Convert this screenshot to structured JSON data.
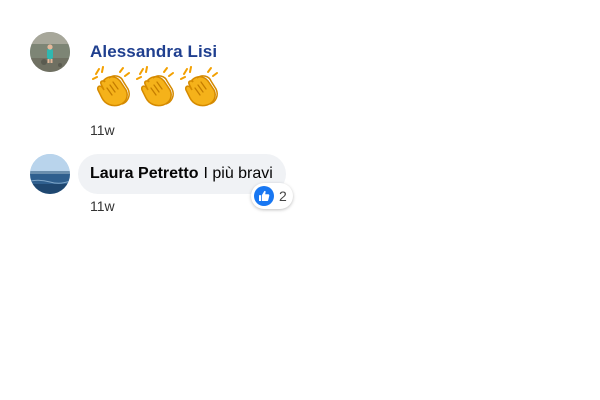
{
  "comments": [
    {
      "author": "Alessandra Lisi",
      "emoji_icons": [
        "clapping-hands-icon",
        "clapping-hands-icon",
        "clapping-hands-icon"
      ],
      "timestamp": "11w"
    },
    {
      "author": "Laura Petretto",
      "text": "I più bravi",
      "timestamp": "11w",
      "reaction_icon": "like-icon",
      "reaction_count": "2"
    }
  ],
  "colors": {
    "author_link": "#1f3f8f",
    "bubble_bg": "#f0f2f5",
    "like_blue": "#1877f2"
  }
}
